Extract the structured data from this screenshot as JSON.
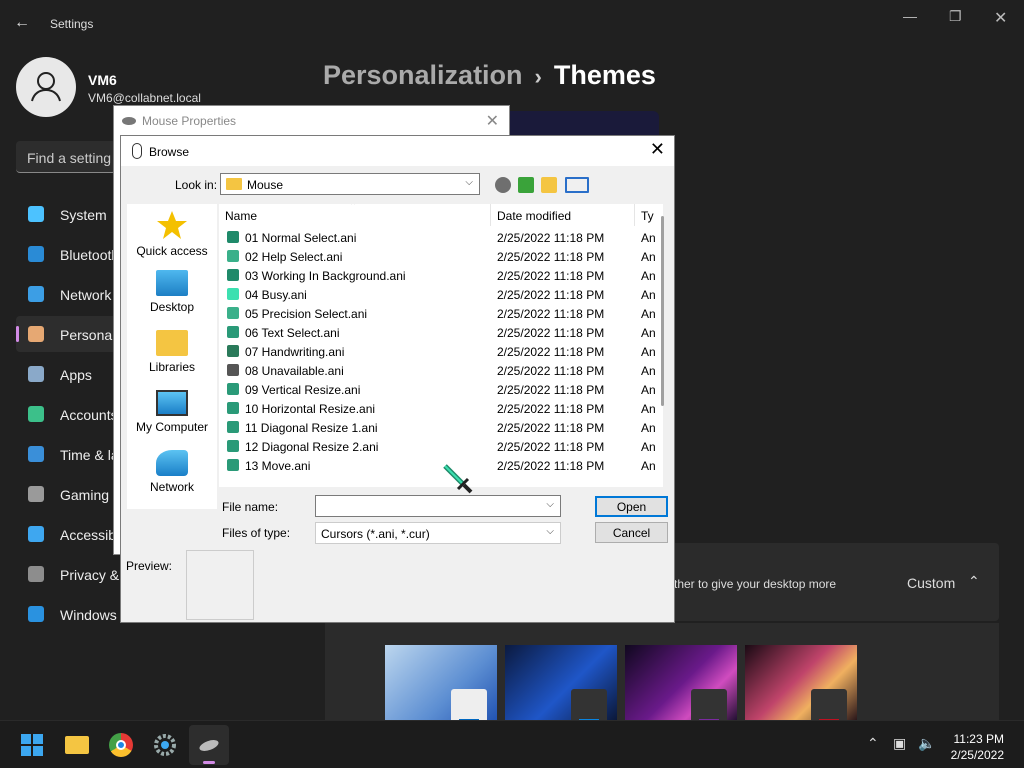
{
  "settings": {
    "title": "Settings",
    "user_name": "VM6",
    "user_email": "VM6@collabnet.local",
    "search_placeholder": "Find a setting",
    "breadcrumb_parent": "Personalization",
    "breadcrumb_sep": "›",
    "breadcrumb_current": "Themes",
    "nav": [
      {
        "label": "System",
        "color": "#4cc2ff"
      },
      {
        "label": "Bluetooth & devices",
        "color": "#2a8bd6"
      },
      {
        "label": "Network & internet",
        "color": "#3c9ee5"
      },
      {
        "label": "Personalization",
        "color": "#e6a873"
      },
      {
        "label": "Apps",
        "color": "#8aa9c9"
      },
      {
        "label": "Accounts",
        "color": "#3cc08a"
      },
      {
        "label": "Time & language",
        "color": "#3a8fd9"
      },
      {
        "label": "Gaming",
        "color": "#9a9a9a"
      },
      {
        "label": "Accessibility",
        "color": "#3ea7f0"
      },
      {
        "label": "Privacy & security",
        "color": "#8d8d8d"
      },
      {
        "label": "Windows Update",
        "color": "#2a92e0"
      }
    ],
    "panel_text": "ther to give your desktop more",
    "panel_value": "Custom"
  },
  "mouse_properties": {
    "title": "Mouse Properties"
  },
  "browse": {
    "title": "Browse",
    "look_in_label": "Look in:",
    "look_in_value": "Mouse",
    "places": [
      "Quick access",
      "Desktop",
      "Libraries",
      "My Computer",
      "Network"
    ],
    "col_name": "Name",
    "col_date": "Date modified",
    "col_type": "Ty",
    "files": [
      {
        "name": "01 Normal Select.ani",
        "date": "2/25/2022 11:18 PM",
        "type": "An"
      },
      {
        "name": "02 Help Select.ani",
        "date": "2/25/2022 11:18 PM",
        "type": "An"
      },
      {
        "name": "03 Working In Background.ani",
        "date": "2/25/2022 11:18 PM",
        "type": "An"
      },
      {
        "name": "04 Busy.ani",
        "date": "2/25/2022 11:18 PM",
        "type": "An"
      },
      {
        "name": "05 Precision Select.ani",
        "date": "2/25/2022 11:18 PM",
        "type": "An"
      },
      {
        "name": "06 Text Select.ani",
        "date": "2/25/2022 11:18 PM",
        "type": "An"
      },
      {
        "name": "07 Handwriting.ani",
        "date": "2/25/2022 11:18 PM",
        "type": "An"
      },
      {
        "name": "08 Unavailable.ani",
        "date": "2/25/2022 11:18 PM",
        "type": "An"
      },
      {
        "name": "09 Vertical Resize.ani",
        "date": "2/25/2022 11:18 PM",
        "type": "An"
      },
      {
        "name": "10 Horizontal Resize.ani",
        "date": "2/25/2022 11:18 PM",
        "type": "An"
      },
      {
        "name": "11 Diagonal Resize 1.ani",
        "date": "2/25/2022 11:18 PM",
        "type": "An"
      },
      {
        "name": "12 Diagonal Resize 2.ani",
        "date": "2/25/2022 11:18 PM",
        "type": "An"
      },
      {
        "name": "13 Move.ani",
        "date": "2/25/2022 11:18 PM",
        "type": "An"
      }
    ],
    "file_name_label": "File name:",
    "file_name_value": "",
    "files_type_label": "Files of type:",
    "files_type_value": "Cursors (*.ani, *.cur)",
    "open_label": "Open",
    "cancel_label": "Cancel",
    "preview_label": "Preview:"
  },
  "taskbar": {
    "time": "11:23 PM",
    "date": "2/25/2022"
  },
  "colors": {
    "accent": "#0078d7",
    "selection": "#d28be6"
  }
}
